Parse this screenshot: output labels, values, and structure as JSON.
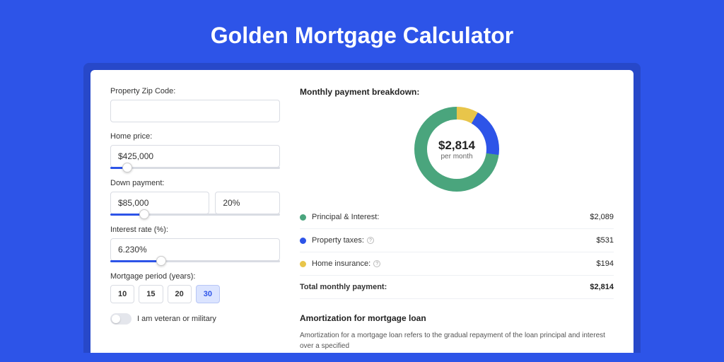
{
  "title": "Golden Mortgage Calculator",
  "form": {
    "zip": {
      "label": "Property Zip Code:",
      "value": ""
    },
    "price": {
      "label": "Home price:",
      "value": "$425,000",
      "slider_pct": 10
    },
    "down": {
      "label": "Down payment:",
      "amount": "$85,000",
      "pct": "20%",
      "slider_pct": 20
    },
    "rate": {
      "label": "Interest rate (%):",
      "value": "6.230%",
      "slider_pct": 30
    },
    "period": {
      "label": "Mortgage period (years):",
      "options": [
        "10",
        "15",
        "20",
        "30"
      ],
      "active": "30"
    },
    "veteran": {
      "label": "I am veteran or military",
      "on": false
    }
  },
  "breakdown": {
    "title": "Monthly payment breakdown:",
    "center_amount": "$2,814",
    "center_sub": "per month",
    "items": [
      {
        "label": "Principal & Interest:",
        "value": "$2,089",
        "color": "#4aa57d",
        "info": false
      },
      {
        "label": "Property taxes:",
        "value": "$531",
        "color": "#2d54e8",
        "info": true
      },
      {
        "label": "Home insurance:",
        "value": "$194",
        "color": "#e8c54a",
        "info": true
      }
    ],
    "total": {
      "label": "Total monthly payment:",
      "value": "$2,814"
    }
  },
  "chart_data": {
    "type": "pie",
    "title": "Monthly payment breakdown",
    "series": [
      {
        "name": "Principal & Interest",
        "value": 2089,
        "color": "#4aa57d"
      },
      {
        "name": "Property taxes",
        "value": 531,
        "color": "#2d54e8"
      },
      {
        "name": "Home insurance",
        "value": 194,
        "color": "#e8c54a"
      }
    ],
    "total": 2814,
    "center_label": "$2,814 per month"
  },
  "amortization": {
    "title": "Amortization for mortgage loan",
    "text": "Amortization for a mortgage loan refers to the gradual repayment of the loan principal and interest over a specified"
  }
}
